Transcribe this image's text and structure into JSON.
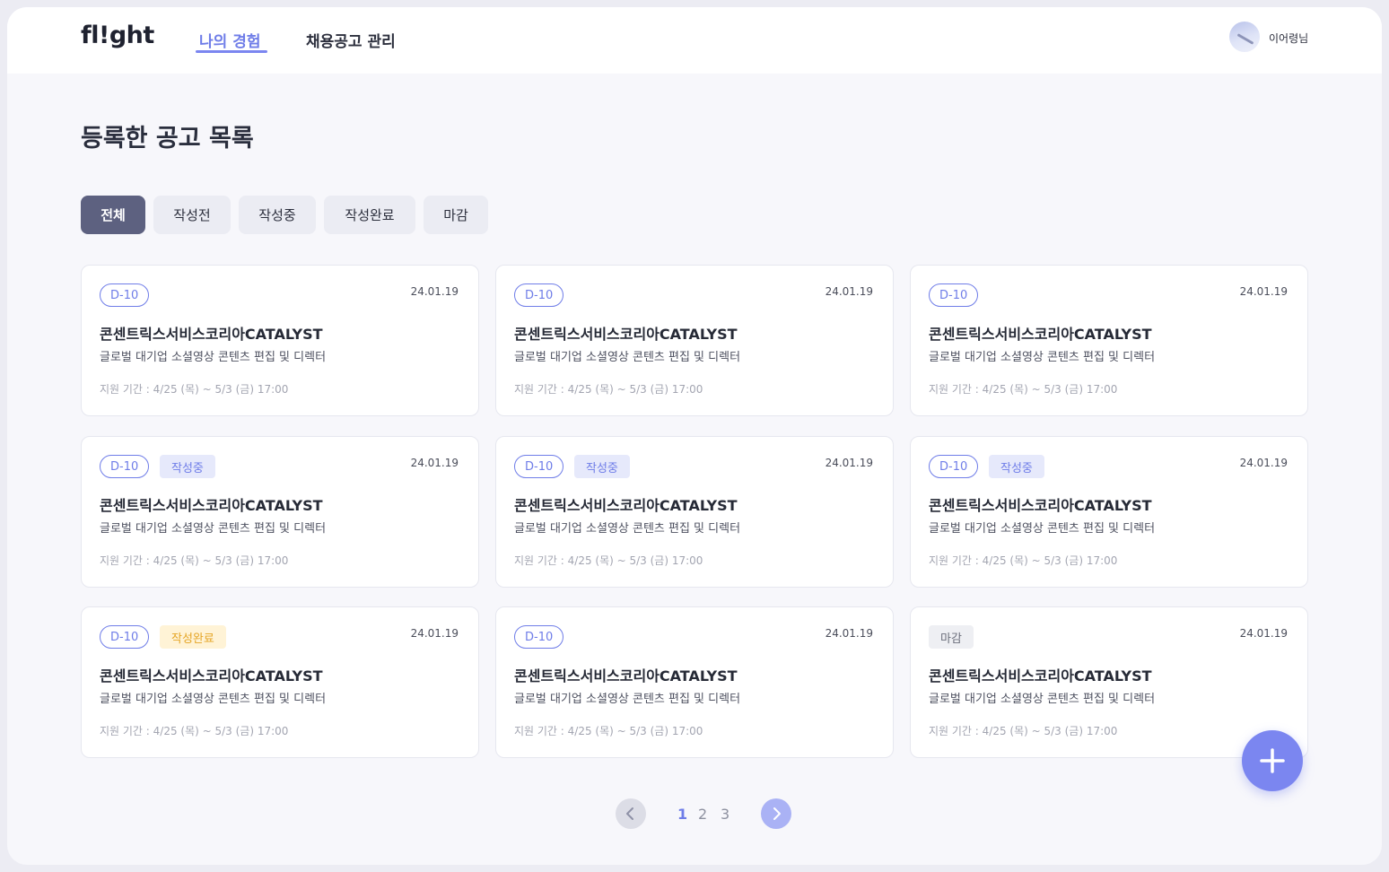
{
  "header": {
    "logo": "fl!ght",
    "nav": [
      {
        "label": "나의 경험",
        "active": true
      },
      {
        "label": "채용공고 관리",
        "active": false
      }
    ],
    "user_name": "이어령님"
  },
  "page_title": "등록한 공고 목록",
  "filters": [
    {
      "label": "전체",
      "active": true
    },
    {
      "label": "작성전",
      "active": false
    },
    {
      "label": "작성중",
      "active": false
    },
    {
      "label": "작성완료",
      "active": false
    },
    {
      "label": "마감",
      "active": false
    }
  ],
  "cards": [
    {
      "dday": "D-10",
      "status": "",
      "date": "24.01.19",
      "company": "콘센트릭스서비스코리아CATALYST",
      "desc": "글로벌 대기업 소셜영상 콘텐츠 편집 및 디렉터",
      "period": "지원 기간 : 4/25 (목) ~ 5/3 (금) 17:00"
    },
    {
      "dday": "D-10",
      "status": "",
      "date": "24.01.19",
      "company": "콘센트릭스서비스코리아CATALYST",
      "desc": "글로벌 대기업 소셜영상 콘텐츠 편집 및 디렉터",
      "period": "지원 기간 : 4/25 (목) ~ 5/3 (금) 17:00"
    },
    {
      "dday": "D-10",
      "status": "",
      "date": "24.01.19",
      "company": "콘센트릭스서비스코리아CATALYST",
      "desc": "글로벌 대기업 소셜영상 콘텐츠 편집 및 디렉터",
      "period": "지원 기간 : 4/25 (목) ~ 5/3 (금) 17:00"
    },
    {
      "dday": "D-10",
      "status": "작성중",
      "date": "24.01.19",
      "company": "콘센트릭스서비스코리아CATALYST",
      "desc": "글로벌 대기업 소셜영상 콘텐츠 편집 및 디렉터",
      "period": "지원 기간 : 4/25 (목) ~ 5/3 (금) 17:00"
    },
    {
      "dday": "D-10",
      "status": "작성중",
      "date": "24.01.19",
      "company": "콘센트릭스서비스코리아CATALYST",
      "desc": "글로벌 대기업 소셜영상 콘텐츠 편집 및 디렉터",
      "period": "지원 기간 : 4/25 (목) ~ 5/3 (금) 17:00"
    },
    {
      "dday": "D-10",
      "status": "작성중",
      "date": "24.01.19",
      "company": "콘센트릭스서비스코리아CATALYST",
      "desc": "글로벌 대기업 소셜영상 콘텐츠 편집 및 디렉터",
      "period": "지원 기간 : 4/25 (목) ~ 5/3 (금) 17:00"
    },
    {
      "dday": "D-10",
      "status": "작성완료",
      "date": "24.01.19",
      "company": "콘센트릭스서비스코리아CATALYST",
      "desc": "글로벌 대기업 소셜영상 콘텐츠 편집 및 디렉터",
      "period": "지원 기간 : 4/25 (목) ~ 5/3 (금) 17:00"
    },
    {
      "dday": "D-10",
      "status": "",
      "date": "24.01.19",
      "company": "콘센트릭스서비스코리아CATALYST",
      "desc": "글로벌 대기업 소셜영상 콘텐츠 편집 및 디렉터",
      "period": "지원 기간 : 4/25 (목) ~ 5/3 (금) 17:00"
    },
    {
      "dday": "",
      "status": "마감",
      "date": "24.01.19",
      "company": "콘센트릭스서비스코리아CATALYST",
      "desc": "글로벌 대기업 소셜영상 콘텐츠 편집 및 디렉터",
      "period": "지원 기간 : 4/25 (목) ~ 5/3 (금) 17:00"
    }
  ],
  "pagination": {
    "pages": [
      "1",
      "2",
      "3"
    ],
    "current": "1",
    "prev_icon": "chevron-left-icon",
    "next_icon": "chevron-right-icon"
  },
  "fab_icon": "plus-icon",
  "colors": {
    "accent": "#7b86f0",
    "filter_active": "#5d6180",
    "status_writing_bg": "#e6e9fb",
    "status_done_bg": "#fff3d6",
    "status_done_text": "#e5a526",
    "status_closed_bg": "#eeeff3"
  }
}
